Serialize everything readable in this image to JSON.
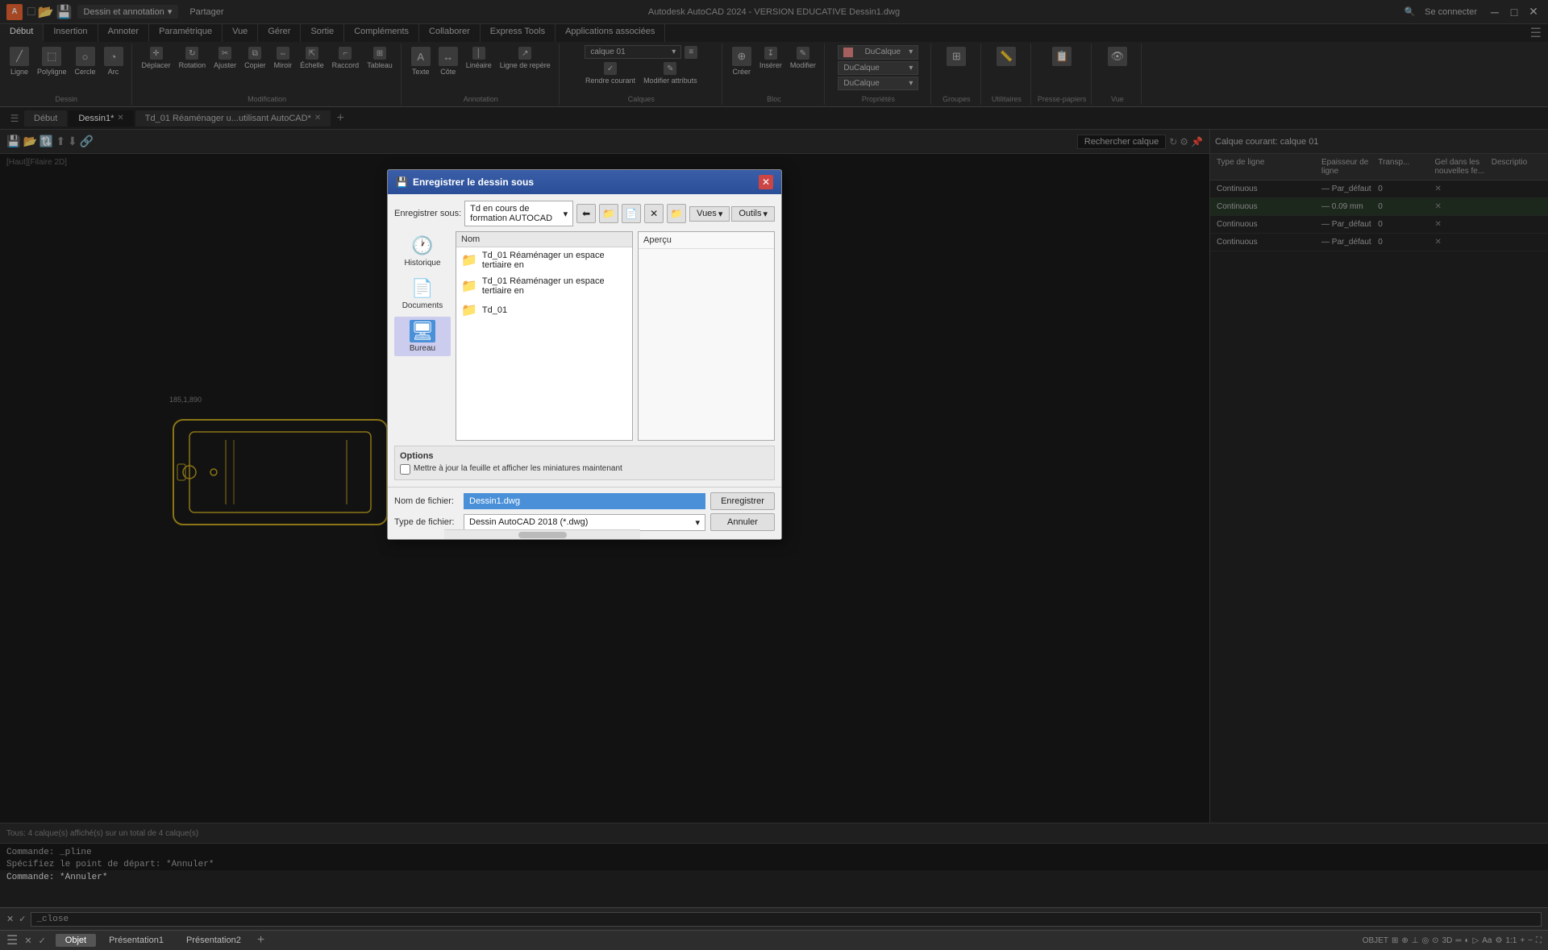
{
  "app": {
    "title": "Autodesk AutoCAD 2024 - VERSION EDUCATIVE   Dessin1.dwg",
    "icon_label": "A",
    "share_label": "Partager",
    "search_connect": "Se connecter"
  },
  "titlebar": {
    "title": "Autodesk AutoCAD 2024 - VERSION EDUCATIVE   Dessin1.dwg",
    "minimize": "─",
    "maximize": "□",
    "close": "✕"
  },
  "ribbon": {
    "workspace": "Dessin et annotation",
    "tabs": [
      {
        "label": "Début",
        "active": true
      },
      {
        "label": "Insertion"
      },
      {
        "label": "Annoter"
      },
      {
        "label": "Paramétrique"
      },
      {
        "label": "Vue"
      },
      {
        "label": "Gérer"
      },
      {
        "label": "Sortie"
      },
      {
        "label": "Compléments"
      },
      {
        "label": "Collaborer"
      },
      {
        "label": "Express Tools"
      },
      {
        "label": "Applications associées"
      }
    ],
    "groups": {
      "dessin": {
        "label": "Dessin",
        "buttons": [
          "Ligne, Polyligne",
          "Cercle",
          "Arc"
        ]
      },
      "modification": {
        "label": "Modification",
        "buttons": [
          "Déplacer",
          "Rotation",
          "Ajuster",
          "Copier",
          "Miroir",
          "Échelle"
        ]
      },
      "annotation": {
        "label": "Annotation",
        "buttons": [
          "Texte",
          "Côte",
          "Linéaire",
          "Ligne de repère"
        ]
      },
      "calques": {
        "label": "Calques",
        "current": "calque 01",
        "buttons": [
          "Propriétés des calques",
          "Rendre courant",
          "Modifier attributs"
        ]
      },
      "bloc": {
        "label": "Bloc",
        "buttons": [
          "Créer",
          "Insérer",
          "Modifier"
        ]
      },
      "proprietes": {
        "label": "Propriétés",
        "current": "DuCalque",
        "buttons": []
      },
      "groupes": {
        "label": "Groupes"
      },
      "utilitaires": {
        "label": "Utilitaires"
      },
      "presse_papiers": {
        "label": "Presse-papiers"
      },
      "vue": {
        "label": "Vue"
      }
    }
  },
  "doc_tabs": [
    {
      "label": "Début"
    },
    {
      "label": "Dessin1*",
      "active": true,
      "closeable": true
    },
    {
      "label": "Td_01 Réaménager u...utilisant AutoCAD*",
      "closeable": true
    }
  ],
  "canvas": {
    "coord_label": "[Haut][Filaire 2D]",
    "drawing_label": "185,1,890"
  },
  "layer_panel": {
    "title": "Calque courant: calque 01",
    "columns": [
      "Type de ligne",
      "Epaisseur de ligne",
      "Transp...",
      "Gel dans les nouvelles fe...",
      "Descriptio"
    ],
    "rows": [
      {
        "type": "Continuous",
        "epaisseur": "— Par_défaut",
        "transp": "0",
        "gel": "",
        "desc": ""
      },
      {
        "type": "Continuous",
        "epaisseur": "— 0.09 mm",
        "transp": "0",
        "gel": "",
        "desc": ""
      },
      {
        "type": "Continuous",
        "epaisseur": "— Par_défaut",
        "transp": "0",
        "gel": "",
        "desc": ""
      },
      {
        "type": "Continuous",
        "epaisseur": "— Par_défaut",
        "transp": "0",
        "gel": "",
        "desc": ""
      }
    ]
  },
  "status_bar": {
    "text": "Tous: 4 calque(s) affiché(s) sur un total de 4 calque(s)"
  },
  "command_area": {
    "lines": [
      {
        "text": "Commande: _pline",
        "highlight": false
      },
      {
        "text": "Spécifiez le point de départ: *Annuler*",
        "highlight": false
      },
      {
        "text": "Commande: *Annuler*",
        "highlight": false
      }
    ]
  },
  "command_input": {
    "placeholder": "_close",
    "icons": [
      "✕",
      "✓"
    ]
  },
  "bottom_tabs": [
    {
      "label": "Objet",
      "active": true
    },
    {
      "label": "Présentation1"
    },
    {
      "label": "Présentation2"
    }
  ],
  "save_dialog": {
    "title": "Enregistrer le dessin sous",
    "icon": "💾",
    "close_icon": "✕",
    "location_label": "Enregistrer sous:",
    "location_value": "Td en cours de formation AUTOCAD",
    "toolbar_icons": [
      "⬅",
      "📁",
      "📄",
      "✕",
      "📁"
    ],
    "views_label": "Vues",
    "tools_label": "Outils",
    "sidebar": [
      {
        "label": "Historique",
        "icon": "🕐"
      },
      {
        "label": "Documents",
        "icon": "📄"
      },
      {
        "label": "Bureau",
        "icon": "🖥",
        "active": true
      }
    ],
    "file_list": {
      "column": "Nom",
      "files": [
        {
          "name": "Td_01 Réaménager un espace tertiaire en",
          "type": "folder"
        },
        {
          "name": "Td_01 Réaménager un espace tertiaire en",
          "type": "folder"
        },
        {
          "name": "Td_01",
          "type": "folder"
        }
      ]
    },
    "preview": {
      "label": "Aperçu"
    },
    "options": {
      "label": "Options",
      "checkbox": "Mettre à jour la feuille et afficher les miniatures maintenant"
    },
    "footer": {
      "filename_label": "Nom de fichier:",
      "filename_value": "Dessin1.dwg",
      "filetype_label": "Type de fichier:",
      "filetype_value": "Dessin AutoCAD 2018 (*.dwg)",
      "save_btn": "Enregistrer",
      "cancel_btn": "Annuler"
    }
  }
}
